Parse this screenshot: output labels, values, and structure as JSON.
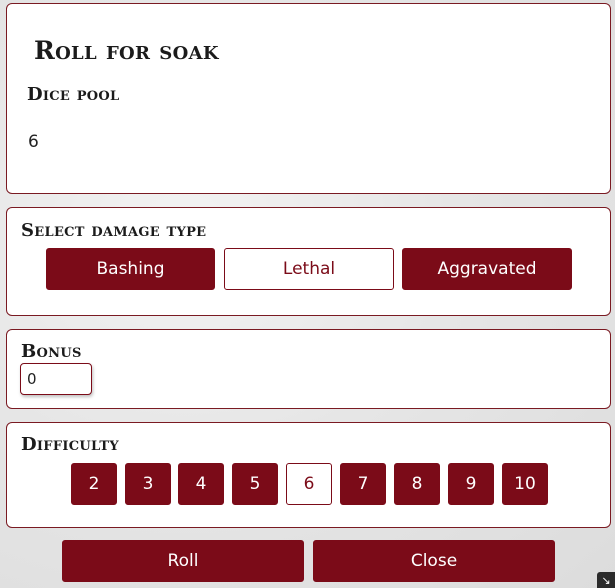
{
  "dialog": {
    "title": "Roll for soak",
    "dice_pool_label": "Dice pool",
    "dice_pool_value": "6"
  },
  "damage": {
    "label": "Select damage type",
    "options": [
      "Bashing",
      "Lethal",
      "Aggravated"
    ],
    "selected": "Lethal"
  },
  "bonus": {
    "label": "Bonus",
    "value": "0"
  },
  "difficulty": {
    "label": "Difficulty",
    "options": [
      "2",
      "3",
      "4",
      "5",
      "6",
      "7",
      "8",
      "9",
      "10"
    ],
    "selected": "6"
  },
  "actions": {
    "roll_label": "Roll",
    "close_label": "Close"
  },
  "colors": {
    "accent": "#7b0b18",
    "border": "#7a1a22"
  },
  "icons": {
    "corner": "resize-handle-icon"
  }
}
